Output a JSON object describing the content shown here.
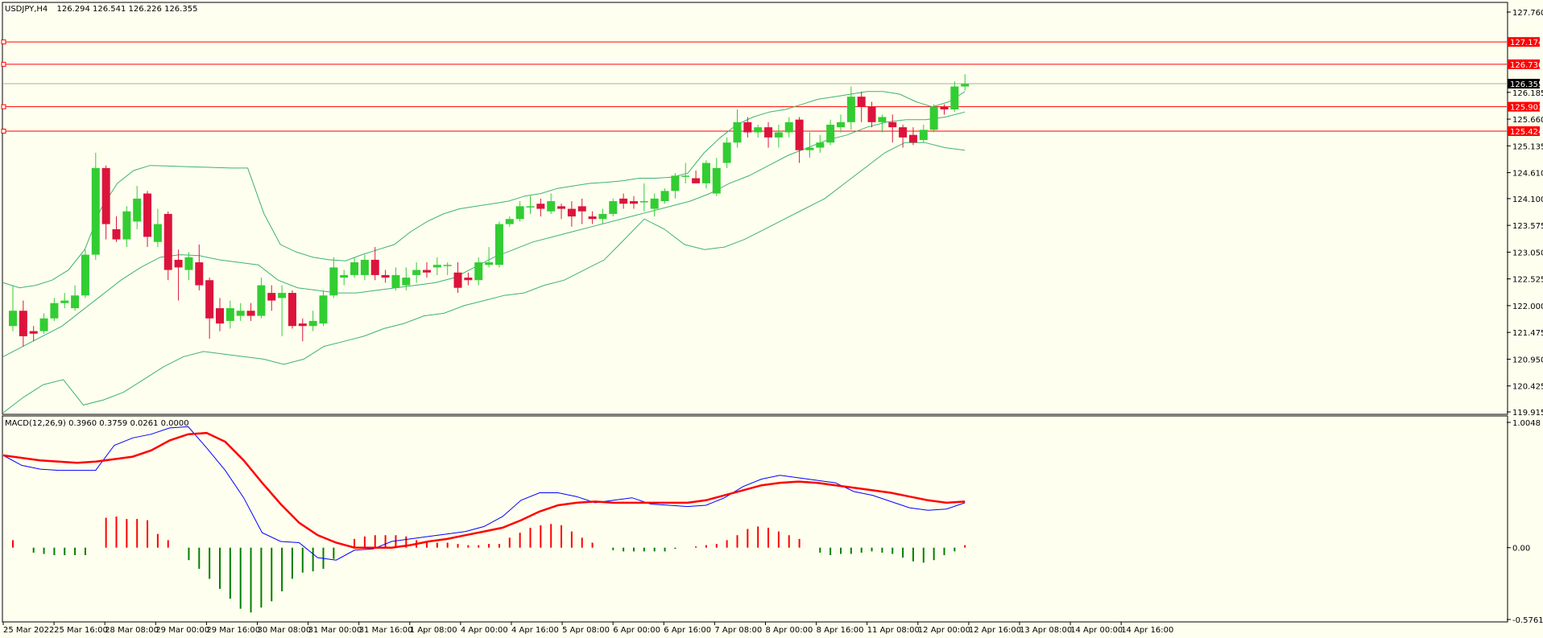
{
  "header": {
    "symbol": "USDJPY,H4",
    "ohlc": "126.294 126.541 126.226 126.355"
  },
  "indicator": {
    "label": "MACD(12,26,9) 0.3960 0.3759 0.0261 0.0000",
    "ticks": [
      "1.0048",
      "0.00",
      "-0.5761"
    ]
  },
  "colors": {
    "background": "#fffff0",
    "bull": "#32cd32",
    "bear": "#dc143c",
    "band": "#3cb371",
    "level": "#ff0000",
    "macd_main": "#0000ff",
    "macd_signal": "#ff0000",
    "hist_pos": "#ff0000",
    "hist_neg": "#008000"
  },
  "price_levels": [
    "127.174",
    "126.736",
    "125.903",
    "125.424"
  ],
  "current_price": "126.355",
  "chart_data": [
    {
      "type": "candlestick",
      "title": "USDJPY,H4",
      "ylim": [
        119.915,
        127.76
      ],
      "y_ticks": [
        "127.760",
        "126.185",
        "125.660",
        "125.135",
        "124.610",
        "124.100",
        "123.575",
        "123.050",
        "122.525",
        "122.000",
        "121.475",
        "120.950",
        "120.425",
        "119.915"
      ],
      "x_ticks": [
        "25 Mar 2022",
        "25 Mar 16:00",
        "28 Mar 08:00",
        "29 Mar 00:00",
        "29 Mar 16:00",
        "30 Mar 08:00",
        "31 Mar 00:00",
        "31 Mar 16:00",
        "1 Apr 08:00",
        "4 Apr 00:00",
        "4 Apr 16:00",
        "5 Apr 08:00",
        "6 Apr 00:00",
        "6 Apr 16:00",
        "7 Apr 08:00",
        "8 Apr 00:00",
        "8 Apr 16:00",
        "11 Apr 08:00",
        "12 Apr 00:00",
        "12 Apr 16:00",
        "13 Apr 08:00",
        "14 Apr 00:00",
        "14 Apr 16:00"
      ],
      "candles": [
        [
          121.6,
          121.9,
          122.4,
          121.5
        ],
        [
          121.9,
          121.4,
          122.1,
          121.2
        ],
        [
          121.5,
          121.45,
          121.6,
          121.3
        ],
        [
          121.5,
          121.75,
          121.85,
          121.45
        ],
        [
          121.75,
          122.05,
          122.15,
          121.7
        ],
        [
          122.05,
          122.1,
          122.25,
          121.95
        ],
        [
          121.95,
          122.2,
          122.4,
          121.9
        ],
        [
          122.2,
          123.0,
          123.1,
          122.15
        ],
        [
          123.0,
          124.7,
          125.0,
          122.9
        ],
        [
          124.7,
          123.6,
          124.75,
          123.3
        ],
        [
          123.5,
          123.3,
          123.75,
          123.25
        ],
        [
          123.3,
          123.85,
          123.95,
          123.15
        ],
        [
          123.65,
          124.1,
          124.35,
          123.5
        ],
        [
          124.2,
          123.35,
          124.25,
          123.15
        ],
        [
          123.25,
          123.6,
          123.9,
          123.15
        ],
        [
          123.8,
          122.7,
          123.85,
          122.5
        ],
        [
          122.9,
          122.75,
          123.1,
          122.1
        ],
        [
          122.7,
          122.95,
          123.05,
          122.5
        ],
        [
          122.85,
          122.4,
          123.2,
          122.3
        ],
        [
          122.5,
          121.75,
          122.55,
          121.35
        ],
        [
          121.95,
          121.65,
          122.15,
          121.5
        ],
        [
          121.7,
          121.95,
          122.1,
          121.55
        ],
        [
          121.8,
          121.9,
          122.05,
          121.7
        ],
        [
          121.9,
          121.8,
          122.05,
          121.7
        ],
        [
          121.8,
          122.4,
          122.55,
          121.75
        ],
        [
          122.25,
          122.1,
          122.4,
          121.9
        ],
        [
          122.15,
          122.25,
          122.4,
          121.4
        ],
        [
          122.25,
          121.6,
          122.3,
          121.55
        ],
        [
          121.65,
          121.6,
          121.75,
          121.3
        ],
        [
          121.6,
          121.7,
          121.9,
          121.5
        ],
        [
          121.65,
          122.2,
          122.3,
          121.6
        ],
        [
          122.2,
          122.75,
          122.95,
          122.15
        ],
        [
          122.55,
          122.6,
          122.7,
          122.4
        ],
        [
          122.6,
          122.85,
          122.95,
          122.55
        ],
        [
          122.6,
          122.9,
          123.0,
          122.5
        ],
        [
          122.9,
          122.6,
          123.15,
          122.5
        ],
        [
          122.6,
          122.55,
          122.7,
          122.45
        ],
        [
          122.35,
          122.6,
          122.75,
          122.3
        ],
        [
          122.4,
          122.55,
          122.75,
          122.3
        ],
        [
          122.6,
          122.7,
          122.85,
          122.45
        ],
        [
          122.7,
          122.65,
          122.85,
          122.55
        ],
        [
          122.75,
          122.8,
          122.95,
          122.6
        ],
        [
          122.8,
          122.8,
          122.85,
          122.6
        ],
        [
          122.65,
          122.35,
          122.85,
          122.25
        ],
        [
          122.55,
          122.5,
          122.65,
          122.4
        ],
        [
          122.5,
          122.85,
          122.95,
          122.4
        ],
        [
          122.8,
          122.85,
          123.15,
          122.75
        ],
        [
          122.8,
          123.6,
          123.65,
          122.75
        ],
        [
          123.6,
          123.7,
          123.75,
          123.55
        ],
        [
          123.7,
          123.95,
          124.05,
          123.65
        ],
        [
          123.95,
          123.95,
          124.15,
          123.8
        ],
        [
          124.0,
          123.9,
          124.1,
          123.75
        ],
        [
          123.85,
          124.05,
          124.2,
          123.8
        ],
        [
          123.95,
          123.9,
          124.0,
          123.7
        ],
        [
          123.9,
          123.75,
          124.05,
          123.55
        ],
        [
          123.95,
          123.85,
          124.1,
          123.6
        ],
        [
          123.75,
          123.7,
          123.85,
          123.6
        ],
        [
          123.7,
          123.8,
          123.9,
          123.6
        ],
        [
          123.8,
          124.05,
          124.1,
          123.75
        ],
        [
          124.1,
          124.0,
          124.2,
          123.9
        ],
        [
          124.05,
          124.0,
          124.15,
          123.9
        ],
        [
          124.05,
          124.05,
          124.4,
          123.85
        ],
        [
          123.9,
          124.1,
          124.2,
          123.75
        ],
        [
          124.05,
          124.25,
          124.3,
          124.0
        ],
        [
          124.25,
          124.55,
          124.6,
          124.1
        ],
        [
          124.55,
          124.55,
          124.8,
          124.4
        ],
        [
          124.5,
          124.4,
          124.65,
          124.4
        ],
        [
          124.4,
          124.8,
          124.85,
          124.3
        ],
        [
          124.2,
          124.7,
          124.9,
          124.15
        ],
        [
          124.8,
          125.2,
          125.3,
          124.7
        ],
        [
          125.2,
          125.6,
          125.85,
          125.1
        ],
        [
          125.6,
          125.4,
          125.7,
          125.3
        ],
        [
          125.4,
          125.5,
          125.55,
          125.3
        ],
        [
          125.5,
          125.3,
          125.6,
          125.1
        ],
        [
          125.3,
          125.4,
          125.55,
          125.1
        ],
        [
          125.4,
          125.6,
          125.7,
          125.3
        ],
        [
          125.65,
          125.05,
          125.7,
          124.8
        ],
        [
          125.05,
          125.1,
          125.4,
          124.9
        ],
        [
          125.1,
          125.2,
          125.35,
          125.0
        ],
        [
          125.2,
          125.55,
          125.65,
          125.15
        ],
        [
          125.5,
          125.6,
          125.75,
          125.4
        ],
        [
          125.6,
          126.1,
          126.3,
          125.45
        ],
        [
          126.1,
          125.9,
          126.2,
          125.6
        ],
        [
          125.9,
          125.6,
          126.0,
          125.5
        ],
        [
          125.6,
          125.7,
          125.75,
          125.4
        ],
        [
          125.6,
          125.5,
          125.75,
          125.2
        ],
        [
          125.5,
          125.3,
          125.55,
          125.1
        ],
        [
          125.35,
          125.2,
          125.5,
          125.15
        ],
        [
          125.25,
          125.45,
          125.55,
          125.2
        ],
        [
          125.45,
          125.9,
          125.95,
          125.4
        ],
        [
          125.9,
          125.85,
          125.95,
          125.75
        ],
        [
          125.85,
          126.3,
          126.4,
          125.8
        ],
        [
          126.3,
          126.35,
          126.54,
          126.22
        ]
      ],
      "bands": {
        "upper": [
          122.45,
          122.35,
          122.4,
          122.5,
          122.7,
          123.1,
          123.9,
          124.4,
          124.65,
          124.75,
          124.74,
          124.73,
          124.72,
          124.71,
          124.7,
          124.7,
          123.8,
          123.2,
          123.05,
          122.95,
          122.9,
          122.88,
          123.0,
          123.1,
          123.2,
          123.45,
          123.65,
          123.8,
          123.9,
          123.95,
          124.0,
          124.05,
          124.15,
          124.2,
          124.3,
          124.35,
          124.4,
          124.42,
          124.45,
          124.5,
          124.5,
          124.52,
          124.6,
          125.0,
          125.3,
          125.55,
          125.7,
          125.8,
          125.85,
          125.95,
          126.05,
          126.1,
          126.15,
          126.2,
          126.2,
          126.15,
          126.0,
          125.9,
          126.0,
          126.2
        ],
        "middle": [
          121.0,
          121.2,
          121.4,
          121.6,
          121.9,
          122.2,
          122.5,
          122.75,
          122.95,
          123.0,
          122.98,
          122.9,
          122.85,
          122.8,
          122.5,
          122.35,
          122.3,
          122.25,
          122.25,
          122.3,
          122.35,
          122.4,
          122.45,
          122.55,
          122.75,
          122.95,
          123.1,
          123.25,
          123.35,
          123.45,
          123.55,
          123.65,
          123.75,
          123.85,
          123.95,
          124.05,
          124.2,
          124.4,
          124.55,
          124.75,
          124.95,
          125.1,
          125.25,
          125.35,
          125.5,
          125.6,
          125.65,
          125.65,
          125.7,
          125.8
        ],
        "lower": [
          119.9,
          120.2,
          120.45,
          120.55,
          120.05,
          120.15,
          120.3,
          120.55,
          120.8,
          121.0,
          121.1,
          121.05,
          121.0,
          120.95,
          120.85,
          120.95,
          121.2,
          121.3,
          121.4,
          121.55,
          121.65,
          121.8,
          121.85,
          122.0,
          122.1,
          122.2,
          122.25,
          122.4,
          122.5,
          122.7,
          122.9,
          123.3,
          123.7,
          123.5,
          123.2,
          123.1,
          123.15,
          123.3,
          123.5,
          123.7,
          123.9,
          124.1,
          124.4,
          124.7,
          125.0,
          125.2,
          125.2,
          125.1,
          125.05
        ]
      }
    },
    {
      "type": "line",
      "title": "MACD(12,26,9)",
      "ylim": [
        -0.5761,
        1.0048
      ],
      "series": [
        {
          "name": "MACD",
          "values": [
            0.74,
            0.66,
            0.63,
            0.62,
            0.62,
            0.62,
            0.82,
            0.88,
            0.91,
            0.96,
            0.97,
            0.8,
            0.62,
            0.4,
            0.12,
            0.05,
            0.04,
            -0.08,
            -0.1,
            -0.02,
            -0.01,
            0.05,
            0.07,
            0.09,
            0.11,
            0.13,
            0.17,
            0.25,
            0.38,
            0.44,
            0.44,
            0.41,
            0.36,
            0.38,
            0.4,
            0.35,
            0.34,
            0.33,
            0.34,
            0.4,
            0.49,
            0.55,
            0.58,
            0.56,
            0.54,
            0.52,
            0.45,
            0.42,
            0.37,
            0.32,
            0.3,
            0.31,
            0.36
          ]
        },
        {
          "name": "Signal",
          "values": [
            0.74,
            0.72,
            0.7,
            0.69,
            0.68,
            0.69,
            0.71,
            0.73,
            0.78,
            0.86,
            0.91,
            0.92,
            0.85,
            0.7,
            0.52,
            0.35,
            0.2,
            0.1,
            0.04,
            0.0,
            0.0,
            0.0,
            0.02,
            0.05,
            0.07,
            0.1,
            0.13,
            0.16,
            0.22,
            0.29,
            0.34,
            0.36,
            0.37,
            0.36,
            0.36,
            0.36,
            0.36,
            0.36,
            0.38,
            0.42,
            0.46,
            0.5,
            0.52,
            0.53,
            0.52,
            0.5,
            0.48,
            0.46,
            0.44,
            0.41,
            0.38,
            0.36,
            0.37
          ]
        },
        {
          "name": "Histogram",
          "values": [
            0.06,
            0.0,
            -0.04,
            -0.05,
            -0.06,
            -0.06,
            -0.06,
            -0.06,
            0.0,
            0.24,
            0.25,
            0.23,
            0.23,
            0.22,
            0.11,
            0.06,
            0.0,
            -0.1,
            -0.17,
            -0.25,
            -0.33,
            -0.41,
            -0.49,
            -0.52,
            -0.48,
            -0.43,
            -0.35,
            -0.25,
            -0.2,
            -0.19,
            -0.17,
            -0.09,
            0.0,
            0.07,
            0.09,
            0.1,
            0.1,
            0.1,
            0.09,
            0.06,
            0.05,
            0.04,
            0.04,
            0.03,
            0.02,
            0.02,
            0.03,
            0.03,
            0.08,
            0.12,
            0.16,
            0.18,
            0.19,
            0.18,
            0.13,
            0.08,
            0.04,
            0.0,
            -0.02,
            -0.03,
            -0.03,
            -0.03,
            -0.03,
            -0.03,
            -0.01,
            0.0,
            0.01,
            0.02,
            0.03,
            0.06,
            0.1,
            0.15,
            0.17,
            0.16,
            0.13,
            0.1,
            0.07,
            0.0,
            -0.04,
            -0.06,
            -0.05,
            -0.05,
            -0.04,
            -0.03,
            -0.04,
            -0.05,
            -0.08,
            -0.11,
            -0.12,
            -0.1,
            -0.06,
            -0.03,
            0.02
          ]
        }
      ]
    }
  ]
}
